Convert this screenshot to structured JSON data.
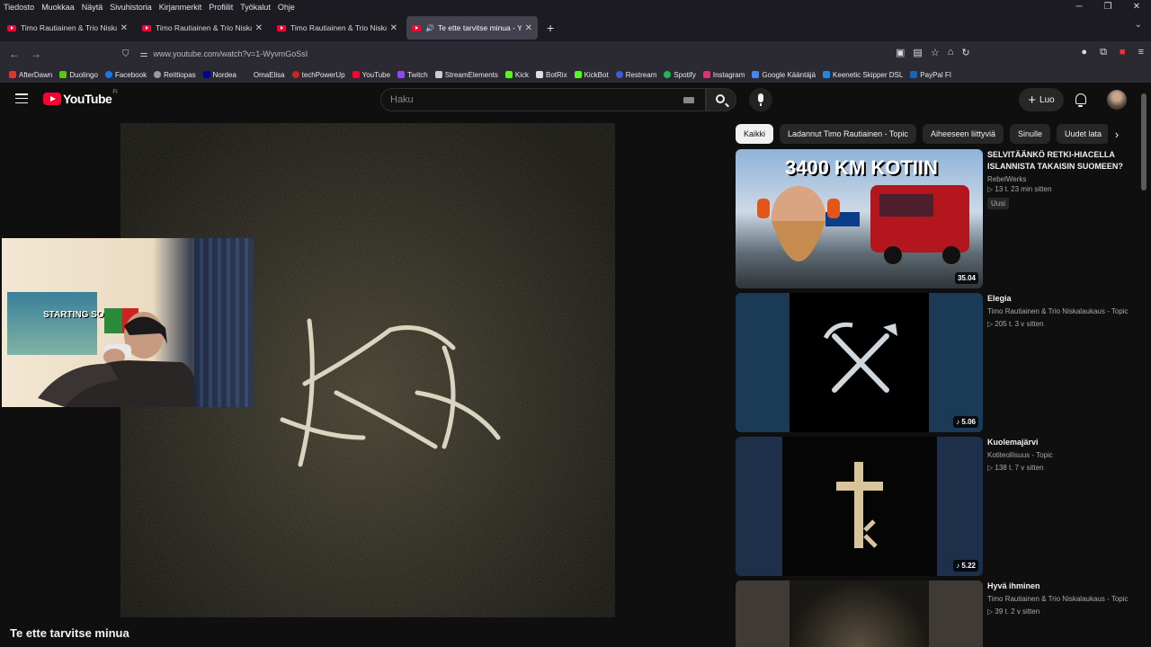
{
  "browser": {
    "menu": [
      "Tiedosto",
      "Muokkaa",
      "Näytä",
      "Sivuhistoria",
      "Kirjanmerkit",
      "Profiilit",
      "Työkalut",
      "Ohje"
    ],
    "tabs": [
      {
        "title": "Timo Rautiainen & Trio Niskalaukaus",
        "active": false
      },
      {
        "title": "Timo Rautiainen & Trio Niskalaukaus",
        "active": false
      },
      {
        "title": "Timo Rautiainen & Trio Niskalaukaus",
        "active": false
      },
      {
        "title": "Te ette tarvitse minua - YouTube",
        "active": true
      }
    ],
    "url": "www.youtube.com/watch?v=1-WyvmGoSsI",
    "bookmarks": [
      {
        "label": "AfterDawn",
        "color": "#d33"
      },
      {
        "label": "Duolingo",
        "color": "#58cc02"
      },
      {
        "label": "Facebook",
        "color": "#1877f2"
      },
      {
        "label": "Reittiopas",
        "color": "#999"
      },
      {
        "label": "Nordea",
        "color": "#0000a0"
      },
      {
        "label": "OmaElisa",
        "color": "#2b2a33"
      },
      {
        "label": "techPowerUp",
        "color": "#c22"
      },
      {
        "label": "YouTube",
        "color": "#ff0033"
      },
      {
        "label": "Twitch",
        "color": "#9146ff"
      },
      {
        "label": "StreamElements",
        "color": "#ccc"
      },
      {
        "label": "Kick",
        "color": "#53fc18"
      },
      {
        "label": "BotRix",
        "color": "#ddd"
      },
      {
        "label": "KickBot",
        "color": "#53fc18"
      },
      {
        "label": "Restream",
        "color": "#3b5bdb"
      },
      {
        "label": "Spotify",
        "color": "#1db954"
      },
      {
        "label": "Instagram",
        "color": "#e1306c"
      },
      {
        "label": "Google Kääntäjä",
        "color": "#4285f4"
      },
      {
        "label": "Keenetic Skipper DSL",
        "color": "#1e88e5"
      },
      {
        "label": "PayPal FI",
        "color": "#1565c0"
      }
    ]
  },
  "youtube": {
    "logo_text": "YouTube",
    "logo_country": "FI",
    "search_placeholder": "Haku",
    "create_label": "Luo",
    "video_title": "Te ette tarvitse minua",
    "webcam_poster_text": "STARTING SOON",
    "chips": [
      {
        "label": "Kaikki",
        "active": true
      },
      {
        "label": "Ladannut Timo Rautiainen - Topic",
        "active": false
      },
      {
        "label": "Aiheeseen liittyviä",
        "active": false
      },
      {
        "label": "Sinulle",
        "active": false
      },
      {
        "label": "Uudet lata",
        "active": false
      }
    ],
    "recommendations": [
      {
        "title": "SELVITÄÄNKÖ RETKI-HIACELLA ISLANNISTA TAKAISIN SUOMEEN?",
        "channel": "RebelWerks",
        "meta": "▷ 13 t.  23 min sitten",
        "badge": "Uusi",
        "duration": "35.04",
        "thumb_text": "3400 KM KOTIIN"
      },
      {
        "title": "Elegia",
        "channel": "Timo Rautiainen & Trio Niskalaukaus - Topic",
        "meta": "▷ 205 t.  3 v sitten",
        "badge": "",
        "duration": "♪ 5.06",
        "thumb_text": ""
      },
      {
        "title": "Kuolemajärvi",
        "channel": "Kotiteollisuus - Topic",
        "meta": "▷ 138 t.  7 v sitten",
        "badge": "",
        "duration": "♪ 5.22",
        "thumb_text": ""
      },
      {
        "title": "Hyvä ihminen",
        "channel": "Timo Rautiainen & Trio Niskalaukaus - Topic",
        "meta": "▷ 39 t.  2 v sitten",
        "badge": "",
        "duration": "",
        "thumb_text": ""
      }
    ]
  }
}
